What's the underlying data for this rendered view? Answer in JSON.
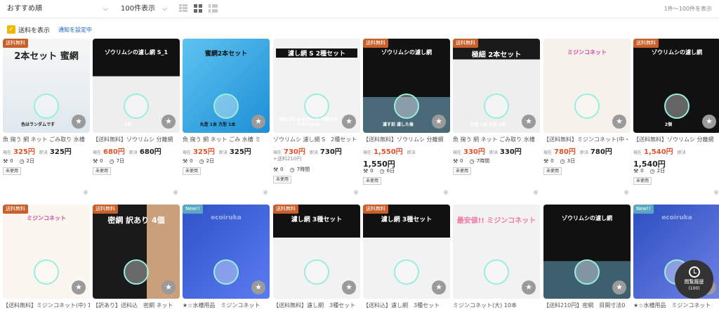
{
  "toolbar": {
    "sort_label": "おすすめ順",
    "per_page_label": "100件表示",
    "range_label": "1件〜100件を表示"
  },
  "filter": {
    "show_shipping_label": "送料を表示",
    "notify_link": "通知を設定中"
  },
  "icons": {
    "chevron": "chevron-down-icon",
    "favorite": "star-icon",
    "bid": "gavel-icon",
    "time": "clock-icon",
    "watch": "eye-icon",
    "history": "history-clock-icon"
  },
  "colors": {
    "price_current": "#e0522a",
    "badge_shipping": "#c9602b",
    "badge_new": "#5aa7c4",
    "check": "#f0b800",
    "link": "#1a62c4"
  },
  "history_button": {
    "label": "閲覧履歴",
    "count": "(100)"
  },
  "items_row1": [
    {
      "badge": "送料無料",
      "title": "魚 掬う 網 ネット ごみ取り 水槽",
      "now_label": "現在",
      "now": "325円",
      "buy_label": "即決",
      "buy": "325円",
      "bids": "0",
      "time": "2日",
      "condition": "未使用",
      "img_text": "2本セット 蜜網",
      "img_sub": "色はランダムです"
    },
    {
      "badge": "",
      "title": "【送料無料】ゾウリムシ 分離網",
      "now_label": "現在",
      "now": "680円",
      "buy_label": "即決",
      "buy": "680円",
      "bids": "0",
      "time": "7日",
      "condition": "未使用",
      "img_text": "ゾウリムシの濾し網 S_1",
      "img_sub": "1個"
    },
    {
      "badge": "",
      "title": "魚 掬う 網 ネット ごみ 水槽 ミ",
      "now_label": "現在",
      "now": "325円",
      "buy_label": "即決",
      "buy": "325円",
      "bids": "0",
      "time": "2日",
      "condition": "未使用",
      "img_text": "蜜網2本セット",
      "img_sub": "丸型 1本 方型 1本"
    },
    {
      "badge": "",
      "title": "ゾウリムシ 濾し網 S　2種セット",
      "now_label": "現在",
      "now": "730円",
      "buy_label": "即決",
      "buy": "730円",
      "ship": "+送料210円",
      "bids": "0",
      "time": "7時間",
      "condition": "未使用",
      "img_text": "濾し網 S 2種セット",
      "img_sub": "目開寸法 0.015mm 目開寸法 0.075mm"
    },
    {
      "badge": "送料無料",
      "title": "【送料無料】ゾウリムシ 分離網",
      "now_label": "現在",
      "now": "1,550円",
      "buy_label": "即決",
      "buy": "1,550円",
      "bids": "0",
      "time": "6日",
      "condition": "未使用",
      "img_text": "ゾウリムシの濾し網",
      "img_sub": "濾す前 濾した後"
    },
    {
      "badge": "送料無料",
      "title": "魚 掬う 網 ネット ごみ取り 水槽",
      "now_label": "現在",
      "now": "330円",
      "buy_label": "即決",
      "buy": "330円",
      "bids": "0",
      "time": "7時間",
      "condition": "未使用",
      "img_text": "極細 2本セット",
      "img_sub": "丸型 1本 方型 1本"
    },
    {
      "badge": "",
      "title": "【送料無料】ミジンコネット(中・",
      "now_label": "現在",
      "now": "780円",
      "buy_label": "即決",
      "buy": "780円",
      "bids": "0",
      "time": "3日",
      "condition": "未使用",
      "img_text": "ミジンコネット",
      "img_sub": ""
    },
    {
      "badge": "送料無料",
      "title": "【送料無料】ゾウリムシ 分離網",
      "now_label": "現在",
      "now": "1,540円",
      "buy_label": "即決",
      "buy": "1,540円",
      "bids": "0",
      "time": "2日",
      "condition": "未使用",
      "img_text": "ゾウリムシの濾し網",
      "img_sub": "2個"
    }
  ],
  "items_row2": [
    {
      "badge": "送料無料",
      "title": "【送料無料】ミジンコネット(中) 1",
      "img_text": "ミジンコネット"
    },
    {
      "badge": "送料無料",
      "title": "【訳あり】送料込　密網 ネット",
      "img_text": "密網 訳あり 4個"
    },
    {
      "badge": "New!!",
      "title": "★☆水槽用品　ミジンコネット",
      "img_text": "ecoiruka"
    },
    {
      "badge": "送料無料",
      "title": "【送料無料】濾し網　3種セット",
      "img_text": "濾し網 3種セット"
    },
    {
      "badge": "送料無料",
      "title": "【送料込】濾し網　3種セット",
      "img_text": "濾し網 3種セット"
    },
    {
      "badge": "",
      "title": "ミジンコネット(大) 10本",
      "img_text": "最安値!! ミジンコネット"
    },
    {
      "badge": "",
      "title": "【送料210円】密網　目開寸法0",
      "img_text": "ゾウリムシの濾し網"
    },
    {
      "badge": "New!!",
      "title": "★☆水槽用品　ミジンコネット",
      "img_text": "ecoiruka"
    }
  ]
}
